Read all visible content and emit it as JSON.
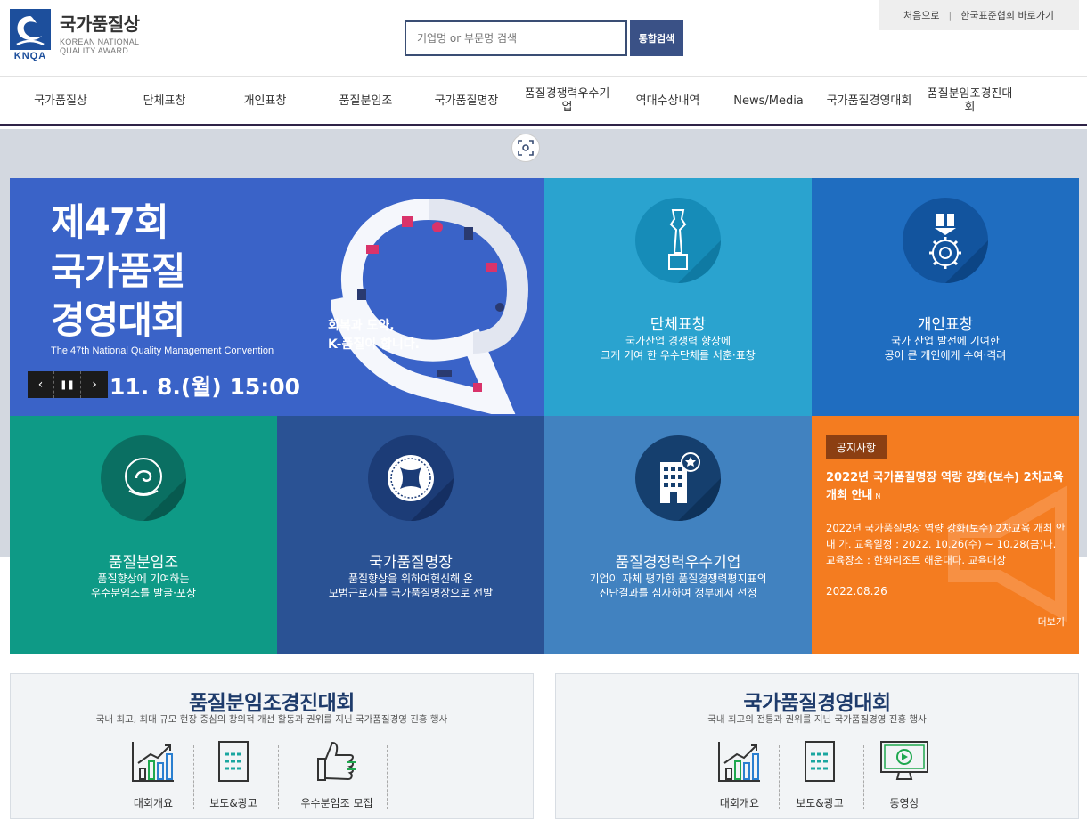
{
  "header": {
    "logo_title": "국가품질상",
    "logo_sub_1": "KOREAN NATIONAL",
    "logo_sub_2": "QUALITY AWARD",
    "logo_mark_text": "KNQA",
    "search_placeholder": "기업명 or 부문명 검색",
    "search_button": "통합검색",
    "util_home": "처음으로",
    "util_sep": "|",
    "util_ksa": "한국표준협회 바로가기"
  },
  "gnb": [
    {
      "label": "국가품질상"
    },
    {
      "label": "단체표창"
    },
    {
      "label": "개인표창"
    },
    {
      "label": "품질분임조"
    },
    {
      "label": "국가품질명장"
    },
    {
      "label": "품질경쟁력우수기업"
    },
    {
      "label": "역대수상내역"
    },
    {
      "label": "News/Media"
    },
    {
      "label": "국가품질경영대회"
    },
    {
      "label": "품질분임조경진대회"
    }
  ],
  "banner": {
    "title_1": "제47회",
    "title_2": "국가품질",
    "title_3": "경영대회",
    "en_title": "The 47th National Quality Management Convention",
    "date": "11. 8.(월) 15:00",
    "slogan_1": "회복과 도약,",
    "slogan_2": "K-품질이 합니다.",
    "ctrl_prev": "‹",
    "ctrl_pause": "❚❚",
    "ctrl_next": "›"
  },
  "tiles": {
    "group": {
      "title": "단체표창",
      "desc_1": "국가산업 경쟁력 향상에",
      "desc_2": "크게 기여 한 우수단체를 서훈·표창"
    },
    "personal": {
      "title": "개인표창",
      "desc_1": "국가 산업 발전에 기여한",
      "desc_2": "공이 큰 개인에게 수여·격려"
    },
    "circle": {
      "title": "품질분임조",
      "desc_1": "품질향상에 기여하는",
      "desc_2": "우수분임조를 발굴·포상"
    },
    "master": {
      "title": "국가품질명장",
      "desc_1": "품질향상을 위하여헌신해 온",
      "desc_2": "모범근로자를 국가품질명장으로 선발"
    },
    "company": {
      "title": "품질경쟁력우수기업",
      "desc_1": "기업이 자체 평가한 품질경쟁력평지표의",
      "desc_2": "진단결과를 심사하여 정부에서 선정"
    }
  },
  "notice": {
    "badge": "공지사항",
    "title": "2022년 국가품질명장 역량 강화(보수) 2차교육 개최 안내",
    "new_mark": "N",
    "body": "2022년 국가품질명장 역량 강화(보수) 2차교육 개최 안내 가. 교육일정 : 2022. 10.26(수) ~ 10.28(금)나. 교육장소 : 한화리조트 해운대다. 교육대상",
    "date": "2022.08.26",
    "more": "더보기"
  },
  "panel_left": {
    "title": "품질분임조경진대회",
    "sub": "국내 최고, 최대 규모 현장 중심의 창의적 개선 활동과 권위를 지닌 국가품질경영 진흥 행사",
    "items": [
      "대회개요",
      "보도&광고",
      "우수분임조 모집"
    ]
  },
  "panel_right": {
    "title": "국가품질경영대회",
    "sub": "국내 최고의 전통과 권위를 지닌 국가품질경영 진흥 행사",
    "items": [
      "대회개요",
      "보도&광고",
      "동영상"
    ]
  },
  "colors": {
    "banner": "#3a63c8",
    "group": "#2aa3cf",
    "personal": "#1f6dc0",
    "circle": "#0e9a86",
    "master": "#2a5294",
    "company": "#4182c0",
    "notice": "#f47c20",
    "nav_border": "#2f2347"
  }
}
